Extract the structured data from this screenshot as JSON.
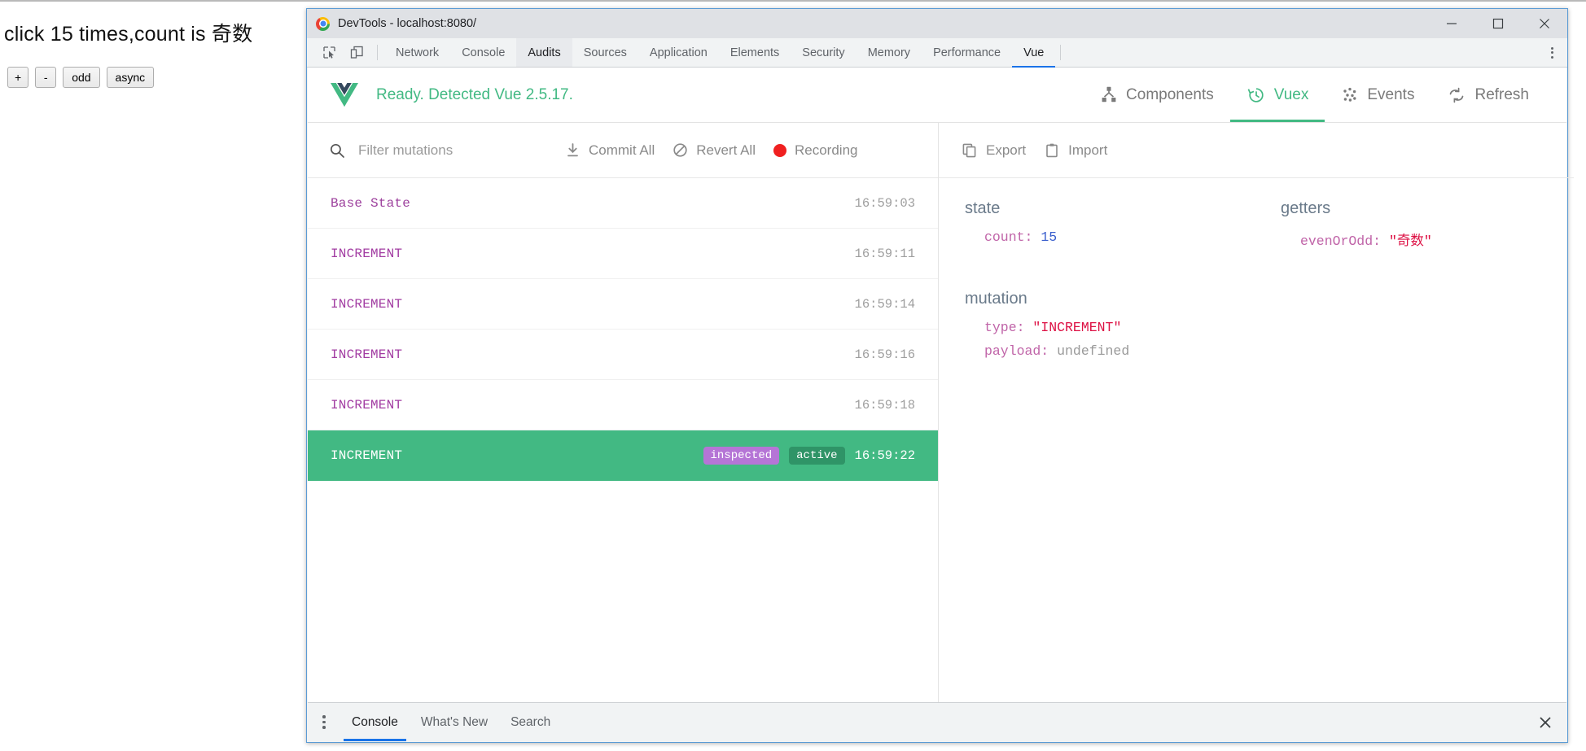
{
  "page": {
    "heading": "click 15 times,count is 奇数",
    "buttons": [
      {
        "label": "+",
        "name": "increment-button"
      },
      {
        "label": "-",
        "name": "decrement-button"
      },
      {
        "label": "odd",
        "name": "odd-button"
      },
      {
        "label": "async",
        "name": "async-button"
      }
    ]
  },
  "window": {
    "title": "DevTools - localhost:8080/",
    "minimize_label": "Minimize",
    "maximize_label": "Maximize",
    "close_label": "Close"
  },
  "devtools_tabs": {
    "inspect_icon": "inspect-element-icon",
    "device_icon": "device-toolbar-icon",
    "items": [
      {
        "label": "Network",
        "state": "normal"
      },
      {
        "label": "Console",
        "state": "normal"
      },
      {
        "label": "Audits",
        "state": "selected"
      },
      {
        "label": "Sources",
        "state": "normal"
      },
      {
        "label": "Application",
        "state": "normal"
      },
      {
        "label": "Elements",
        "state": "normal"
      },
      {
        "label": "Security",
        "state": "normal"
      },
      {
        "label": "Memory",
        "state": "normal"
      },
      {
        "label": "Performance",
        "state": "normal"
      },
      {
        "label": "Vue",
        "state": "active"
      }
    ],
    "more_label": "Customize and control DevTools"
  },
  "vue": {
    "status": "Ready. Detected Vue 2.5.17.",
    "accent_color": "#42b983",
    "nav": [
      {
        "label": "Components",
        "icon": "components-tree-icon",
        "active": false
      },
      {
        "label": "Vuex",
        "icon": "history-clock-icon",
        "active": true
      },
      {
        "label": "Events",
        "icon": "events-dots-icon",
        "active": false
      },
      {
        "label": "Refresh",
        "icon": "refresh-icon",
        "active": false
      }
    ]
  },
  "vuex": {
    "toolbar": {
      "search_icon": "search-icon",
      "filter_placeholder": "Filter mutations",
      "filter_value": "",
      "commit_all_label": "Commit All",
      "revert_all_label": "Revert All",
      "recording_label": "Recording",
      "recording_color": "#f02020",
      "export_label": "Export",
      "import_label": "Import"
    },
    "mutations": [
      {
        "name": "Base State",
        "time": "16:59:03",
        "active": false,
        "tags": []
      },
      {
        "name": "INCREMENT",
        "time": "16:59:11",
        "active": false,
        "tags": []
      },
      {
        "name": "INCREMENT",
        "time": "16:59:14",
        "active": false,
        "tags": []
      },
      {
        "name": "INCREMENT",
        "time": "16:59:16",
        "active": false,
        "tags": []
      },
      {
        "name": "INCREMENT",
        "time": "16:59:18",
        "active": false,
        "tags": []
      },
      {
        "name": "INCREMENT",
        "time": "16:59:22",
        "active": true,
        "tags": [
          "inspected",
          "active"
        ]
      }
    ],
    "detail": {
      "state_title": "state",
      "state_key": "count:",
      "state_value": "15",
      "getters_title": "getters",
      "getters_key": "evenOrOdd:",
      "getters_value": "\"奇数\"",
      "mutation_title": "mutation",
      "mutation_type_key": "type:",
      "mutation_type_value": "\"INCREMENT\"",
      "mutation_payload_key": "payload:",
      "mutation_payload_value": "undefined"
    }
  },
  "drawer": {
    "more_label": "More tools",
    "tabs": [
      {
        "label": "Console",
        "active": true
      },
      {
        "label": "What's New",
        "active": false
      },
      {
        "label": "Search",
        "active": false
      }
    ],
    "close_label": "Close drawer"
  }
}
